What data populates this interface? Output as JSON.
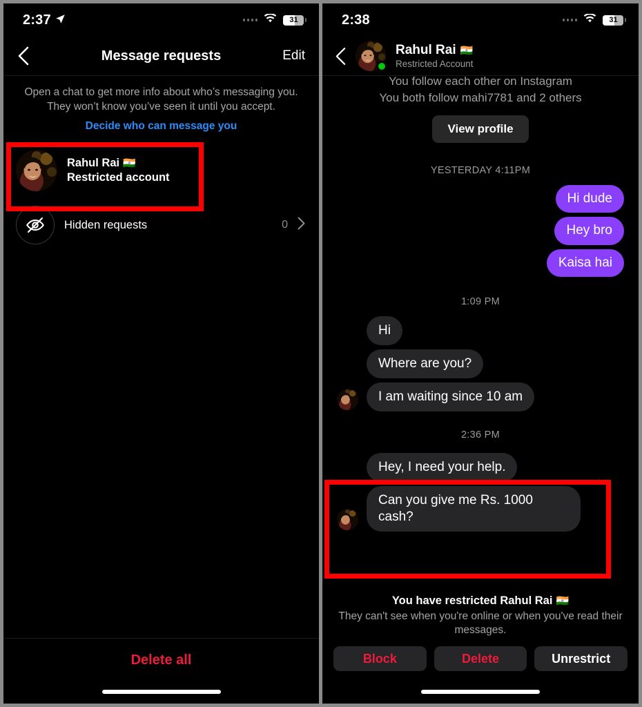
{
  "left": {
    "status": {
      "time": "2:37",
      "location_icon": "location-arrow-icon",
      "battery_level": "31"
    },
    "nav": {
      "back_icon": "chevron-left-icon",
      "title": "Message requests",
      "edit_label": "Edit"
    },
    "info": {
      "line1": "Open a chat to get more info about who’s messaging you.",
      "line2": "They won’t know you’ve seen it until you accept.",
      "link": "Decide who can message you"
    },
    "request": {
      "name": "Rahul Rai",
      "flag": "🇮🇳",
      "subtitle": "Restricted account",
      "avatar_icon": "user-avatar-photo"
    },
    "hidden": {
      "icon": "eye-slash-icon",
      "label": "Hidden requests",
      "count": "0",
      "chevron": "chevron-right-icon"
    },
    "footer": {
      "delete_all": "Delete all"
    },
    "highlight_color": "#ff0000"
  },
  "right": {
    "status": {
      "time": "2:38",
      "battery_level": "31"
    },
    "header": {
      "back_icon": "chevron-left-icon",
      "name": "Rahul Rai",
      "flag": "🇮🇳",
      "subtitle": "Restricted Account",
      "presence": "online-dot",
      "avatar_icon": "user-avatar-photo"
    },
    "intro": {
      "line1": "You follow each other on Instagram",
      "line2": "You both follow mahi7781 and 2 others",
      "view_profile": "View profile"
    },
    "timestamps": {
      "t1": "YESTERDAY 4:11PM",
      "t2": "1:09 PM",
      "t3": "2:36 PM"
    },
    "outgoing": [
      "Hi dude",
      "Hey bro",
      "Kaisa hai"
    ],
    "incoming_group_1": [
      "Hi",
      "Where are you?",
      "I am waiting since 10 am"
    ],
    "incoming_group_2": [
      "Hey, I need your help.",
      "Can you give me Rs. 1000 cash?"
    ],
    "restricted": {
      "title": "You have restricted Rahul Rai",
      "flag": "🇮🇳",
      "subtitle": "They can't see when you're online or when you've read their messages."
    },
    "actions": [
      {
        "label": "Block",
        "style": "red"
      },
      {
        "label": "Delete",
        "style": "red"
      },
      {
        "label": "Unrestrict",
        "style": "white"
      }
    ],
    "bubble_out_color": "#8a3ffb",
    "bubble_in_color": "#262628"
  }
}
